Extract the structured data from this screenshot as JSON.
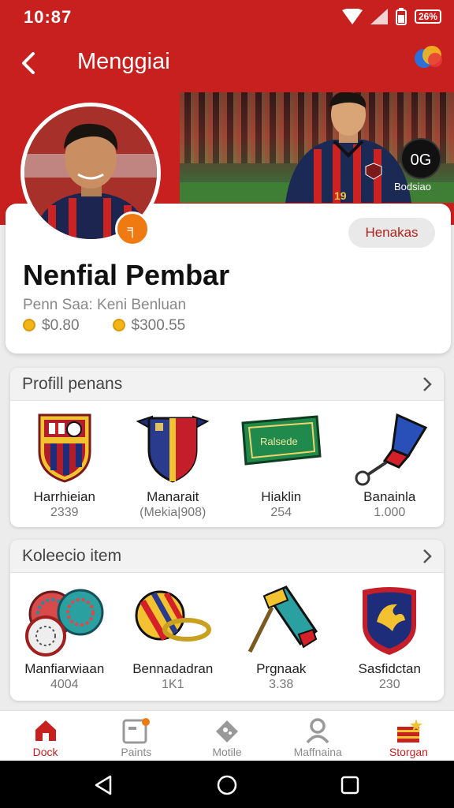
{
  "status": {
    "time": "10:87",
    "battery_badge": "26%"
  },
  "header": {
    "title": "Menggiai"
  },
  "banner": {
    "score": "0G",
    "score_label": "Bodsiao",
    "jersey_number": "19"
  },
  "profile": {
    "follow_label": "Henakas",
    "name": "Nenfial Pembar",
    "subtitle": "Penn Saa: Keni Benluan",
    "stats": [
      {
        "value": "$0.80"
      },
      {
        "value": "$300.55"
      }
    ],
    "badge_icon": "fire-badge-icon"
  },
  "sections": [
    {
      "title": "Profill penans",
      "items": [
        {
          "name": "Harrhieian",
          "value": "2339",
          "icon": "club-crest-icon"
        },
        {
          "name": "Manarait",
          "value": "(Mekia|908)",
          "icon": "shield-crest-icon"
        },
        {
          "name": "Hiaklin",
          "value": "254",
          "icon": "flag-icon",
          "flag_text": "Ralsede"
        },
        {
          "name": "Banainla",
          "value": "1.000",
          "icon": "trophy-cup-icon"
        }
      ]
    },
    {
      "title": "Koleecio item",
      "items": [
        {
          "name": "Manfiarwiaan",
          "value": "4004",
          "icon": "medals-icon"
        },
        {
          "name": "Bennadadran",
          "value": "1K1",
          "icon": "striped-ball-icon"
        },
        {
          "name": "Prgnaak",
          "value": "3.38",
          "icon": "mace-icon"
        },
        {
          "name": "Sasfidctan",
          "value": "230",
          "icon": "eagle-shield-icon"
        }
      ]
    }
  ],
  "bottom_nav": [
    {
      "label": "Dock",
      "icon": "home-icon",
      "active": true
    },
    {
      "label": "Paints",
      "icon": "board-icon",
      "active": false
    },
    {
      "label": "Motile",
      "icon": "tag-icon",
      "active": false
    },
    {
      "label": "Maffnaina",
      "icon": "person-icon",
      "active": false
    },
    {
      "label": "Storgan",
      "icon": "store-icon",
      "active": true
    }
  ],
  "colors": {
    "brand": "#c8201e",
    "accent": "#f07a12",
    "coin": "#f2b416"
  }
}
